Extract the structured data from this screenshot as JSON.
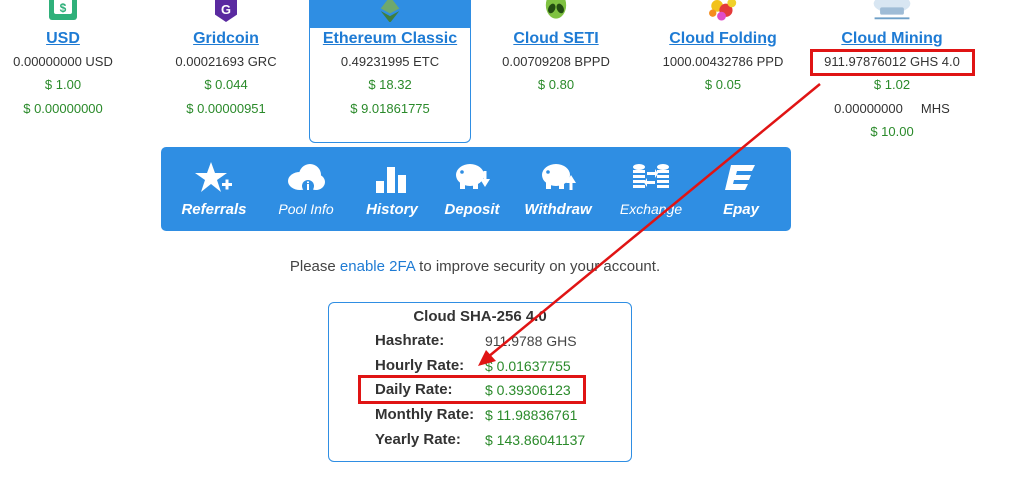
{
  "currencies": [
    {
      "name": "USD",
      "balance": "0.00000000 USD",
      "price": "$ 1.00",
      "value": "$ 0.00000000",
      "icon": "usd-icon"
    },
    {
      "name": "Gridcoin",
      "balance": "0.00021693 GRC",
      "price": "$ 0.044",
      "value": "$ 0.00000951",
      "icon": "gridcoin-icon"
    },
    {
      "name": "Ethereum Classic",
      "balance": "0.49231995 ETC",
      "price": "$ 18.32",
      "value": "$ 9.01861775",
      "icon": "ethereum-classic-icon"
    },
    {
      "name": "Cloud SETI",
      "balance": "0.00709208 BPPD",
      "price": "$ 0.80",
      "icon": "alien-icon"
    },
    {
      "name": "Cloud Folding",
      "balance": "1000.00432786 PPD",
      "price": "$ 0.05",
      "icon": "folding-molecule-icon"
    },
    {
      "name": "Cloud Mining",
      "balance": "911.97876012 GHS 4.0",
      "price": "$ 1.02",
      "extra": "0.00000000     MHS",
      "extra_price": "$ 10.00",
      "icon": "cloud-server-icon"
    }
  ],
  "nav": [
    {
      "label": "Referrals",
      "icon": "star-plus-icon"
    },
    {
      "label": "Pool Info",
      "icon": "cloud-info-icon"
    },
    {
      "label": "History",
      "icon": "bar-chart-icon"
    },
    {
      "label": "Deposit",
      "icon": "piggy-deposit-icon"
    },
    {
      "label": "Withdraw",
      "icon": "piggy-withdraw-icon"
    },
    {
      "label": "Exchange",
      "icon": "exchange-icon"
    },
    {
      "label": "Epay",
      "icon": "epay-icon"
    }
  ],
  "notice": {
    "before": "Please ",
    "link": "enable 2FA",
    "after": " to improve security on your account."
  },
  "card": {
    "title": "Cloud SHA-256 4.0",
    "rows": [
      {
        "label": "Hashrate:",
        "value": "911.9788 GHS"
      },
      {
        "label": "Hourly Rate:",
        "value": "$ 0.01637755"
      },
      {
        "label": "Daily Rate:",
        "value": "$ 0.39306123"
      },
      {
        "label": "Monthly Rate:",
        "value": "$ 11.98836761"
      },
      {
        "label": "Yearly Rate:",
        "value": "$ 143.86041137"
      }
    ]
  },
  "colors": {
    "brand_blue": "#2f8ee3",
    "link_blue": "#1e7bd4",
    "money_green": "#2a8a2a",
    "annotation_red": "#e01414"
  }
}
